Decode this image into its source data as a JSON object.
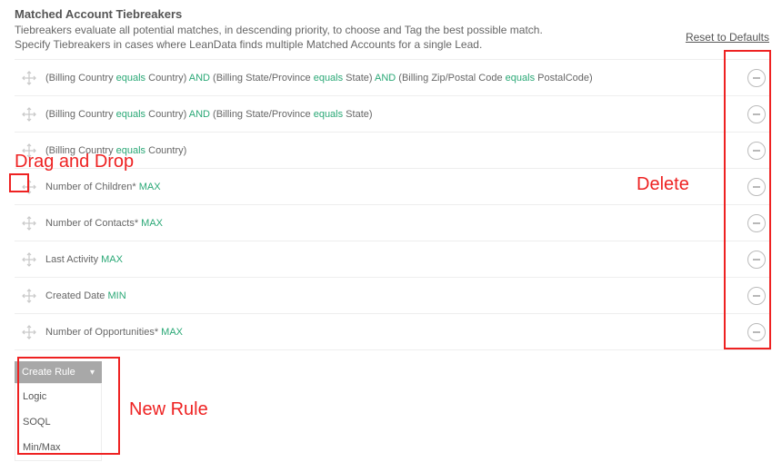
{
  "header": {
    "title": "Matched Account Tiebreakers",
    "desc_line1": "Tiebreakers evaluate all potential matches, in descending priority, to choose and Tag the best possible match.",
    "desc_line2": "Specify Tiebreakers in cases where LeanData finds multiple Matched Accounts for a single Lead.",
    "reset_label": "Reset to Defaults"
  },
  "keywords": {
    "equals": "equals",
    "and": "AND",
    "max": "MAX",
    "min": "MIN"
  },
  "rules": [
    {
      "type": "logic",
      "segments": [
        {
          "t": "(Billing Country "
        },
        {
          "kw": "equals"
        },
        {
          "t": " Country) "
        },
        {
          "kw": "and"
        },
        {
          "t": " (Billing State/Province "
        },
        {
          "kw": "equals"
        },
        {
          "t": " State) "
        },
        {
          "kw": "and"
        },
        {
          "t": " (Billing Zip/Postal Code "
        },
        {
          "kw": "equals"
        },
        {
          "t": " PostalCode)"
        }
      ]
    },
    {
      "type": "logic",
      "segments": [
        {
          "t": "(Billing Country "
        },
        {
          "kw": "equals"
        },
        {
          "t": " Country) "
        },
        {
          "kw": "and"
        },
        {
          "t": " (Billing State/Province "
        },
        {
          "kw": "equals"
        },
        {
          "t": " State)"
        }
      ]
    },
    {
      "type": "logic",
      "segments": [
        {
          "t": "(Billing Country "
        },
        {
          "kw": "equals"
        },
        {
          "t": " Country)"
        }
      ]
    },
    {
      "type": "minmax",
      "field": "Number of Children*",
      "agg": "max"
    },
    {
      "type": "minmax",
      "field": "Number of Contacts*",
      "agg": "max"
    },
    {
      "type": "minmax",
      "field": "Last Activity",
      "agg": "max"
    },
    {
      "type": "minmax",
      "field": "Created Date",
      "agg": "min"
    },
    {
      "type": "minmax",
      "field": "Number of Opportunities*",
      "agg": "max"
    }
  ],
  "create": {
    "button_label": "Create Rule",
    "options": [
      "Logic",
      "SOQL",
      "Min/Max"
    ]
  },
  "annotations": {
    "drag_drop": "Drag and Drop",
    "delete": "Delete",
    "new_rule": "New Rule"
  }
}
